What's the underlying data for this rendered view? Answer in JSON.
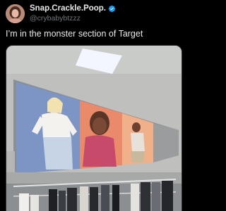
{
  "author": {
    "display_name": "Snap.Crackle.Poop.",
    "handle": "@crybabybtzzz",
    "verified": true,
    "avatar_icon": "avatar-photo"
  },
  "tweet": {
    "text": "I’m in the monster section of Target"
  },
  "media": {
    "type": "photo",
    "subject": "store-interior-with-banner"
  },
  "colors": {
    "background": "#000000",
    "text": "#e7e9ea",
    "secondary_text": "#71767b",
    "verified": "#1d9bf0"
  }
}
